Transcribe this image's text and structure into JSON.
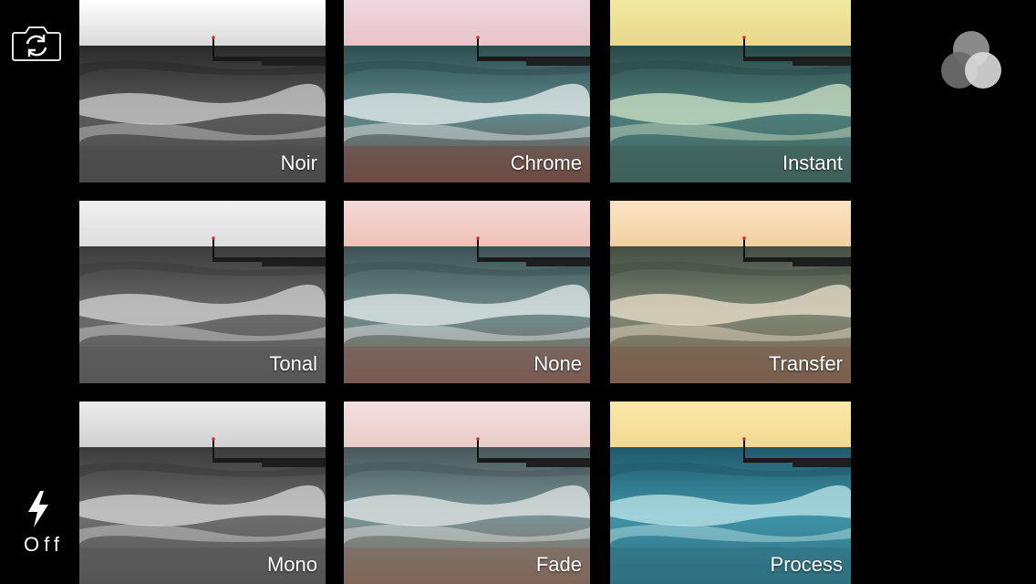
{
  "flash": {
    "label": "Off",
    "icon": "lightning-bolt-icon"
  },
  "camera_switch": {
    "icon": "camera-rotate-icon"
  },
  "filter_toggle": {
    "icon": "three-circles-filter-icon"
  },
  "filters": [
    {
      "name": "Noir",
      "sky": "#ffffff",
      "skyLow": "#d8d8d8",
      "sea": "#5a5a5a",
      "seaDark": "#2a2a2a",
      "foam": "#cfcfcf",
      "sand": "#4a4a4a"
    },
    {
      "name": "Chrome",
      "sky": "#eed7e0",
      "skyLow": "#e9c3c6",
      "sea": "#5f8a8c",
      "seaDark": "#2f4e52",
      "foam": "#e8f0ef",
      "sand": "#6d4a42"
    },
    {
      "name": "Instant",
      "sky": "#f0e8a0",
      "skyLow": "#e8d88a",
      "sea": "#4e7f7a",
      "seaDark": "#2a4a48",
      "foam": "#cfe3c8",
      "sand": "#3f5f5a"
    },
    {
      "name": "Tonal",
      "sky": "#f1f1f1",
      "skyLow": "#dcdcdc",
      "sea": "#6b6b6b",
      "seaDark": "#3c3c3c",
      "foam": "#d5d5d5",
      "sand": "#575757"
    },
    {
      "name": "None",
      "sky": "#f3d9d8",
      "skyLow": "#efc0b5",
      "sea": "#6f8d8c",
      "seaDark": "#3d5255",
      "foam": "#e7edec",
      "sand": "#7a5a50"
    },
    {
      "name": "Transfer",
      "sky": "#fbe4c2",
      "skyLow": "#f3cfa0",
      "sea": "#7c8774",
      "seaDark": "#454e44",
      "foam": "#ece2cc",
      "sand": "#7a5e4a"
    },
    {
      "name": "Mono",
      "sky": "#ececec",
      "skyLow": "#d0d0d0",
      "sea": "#6e6e6e",
      "seaDark": "#3b3b3b",
      "foam": "#d8d8d8",
      "sand": "#555555"
    },
    {
      "name": "Fade",
      "sky": "#f2dfe0",
      "skyLow": "#e9cbc6",
      "sea": "#7a9495",
      "seaDark": "#48585a",
      "foam": "#e3e8e6",
      "sand": "#7f6658"
    },
    {
      "name": "Process",
      "sky": "#fbe8a8",
      "skyLow": "#f2d890",
      "sea": "#3f93a6",
      "seaDark": "#1f5a6c",
      "foam": "#bfe6ea",
      "sand": "#2f6f80"
    }
  ]
}
